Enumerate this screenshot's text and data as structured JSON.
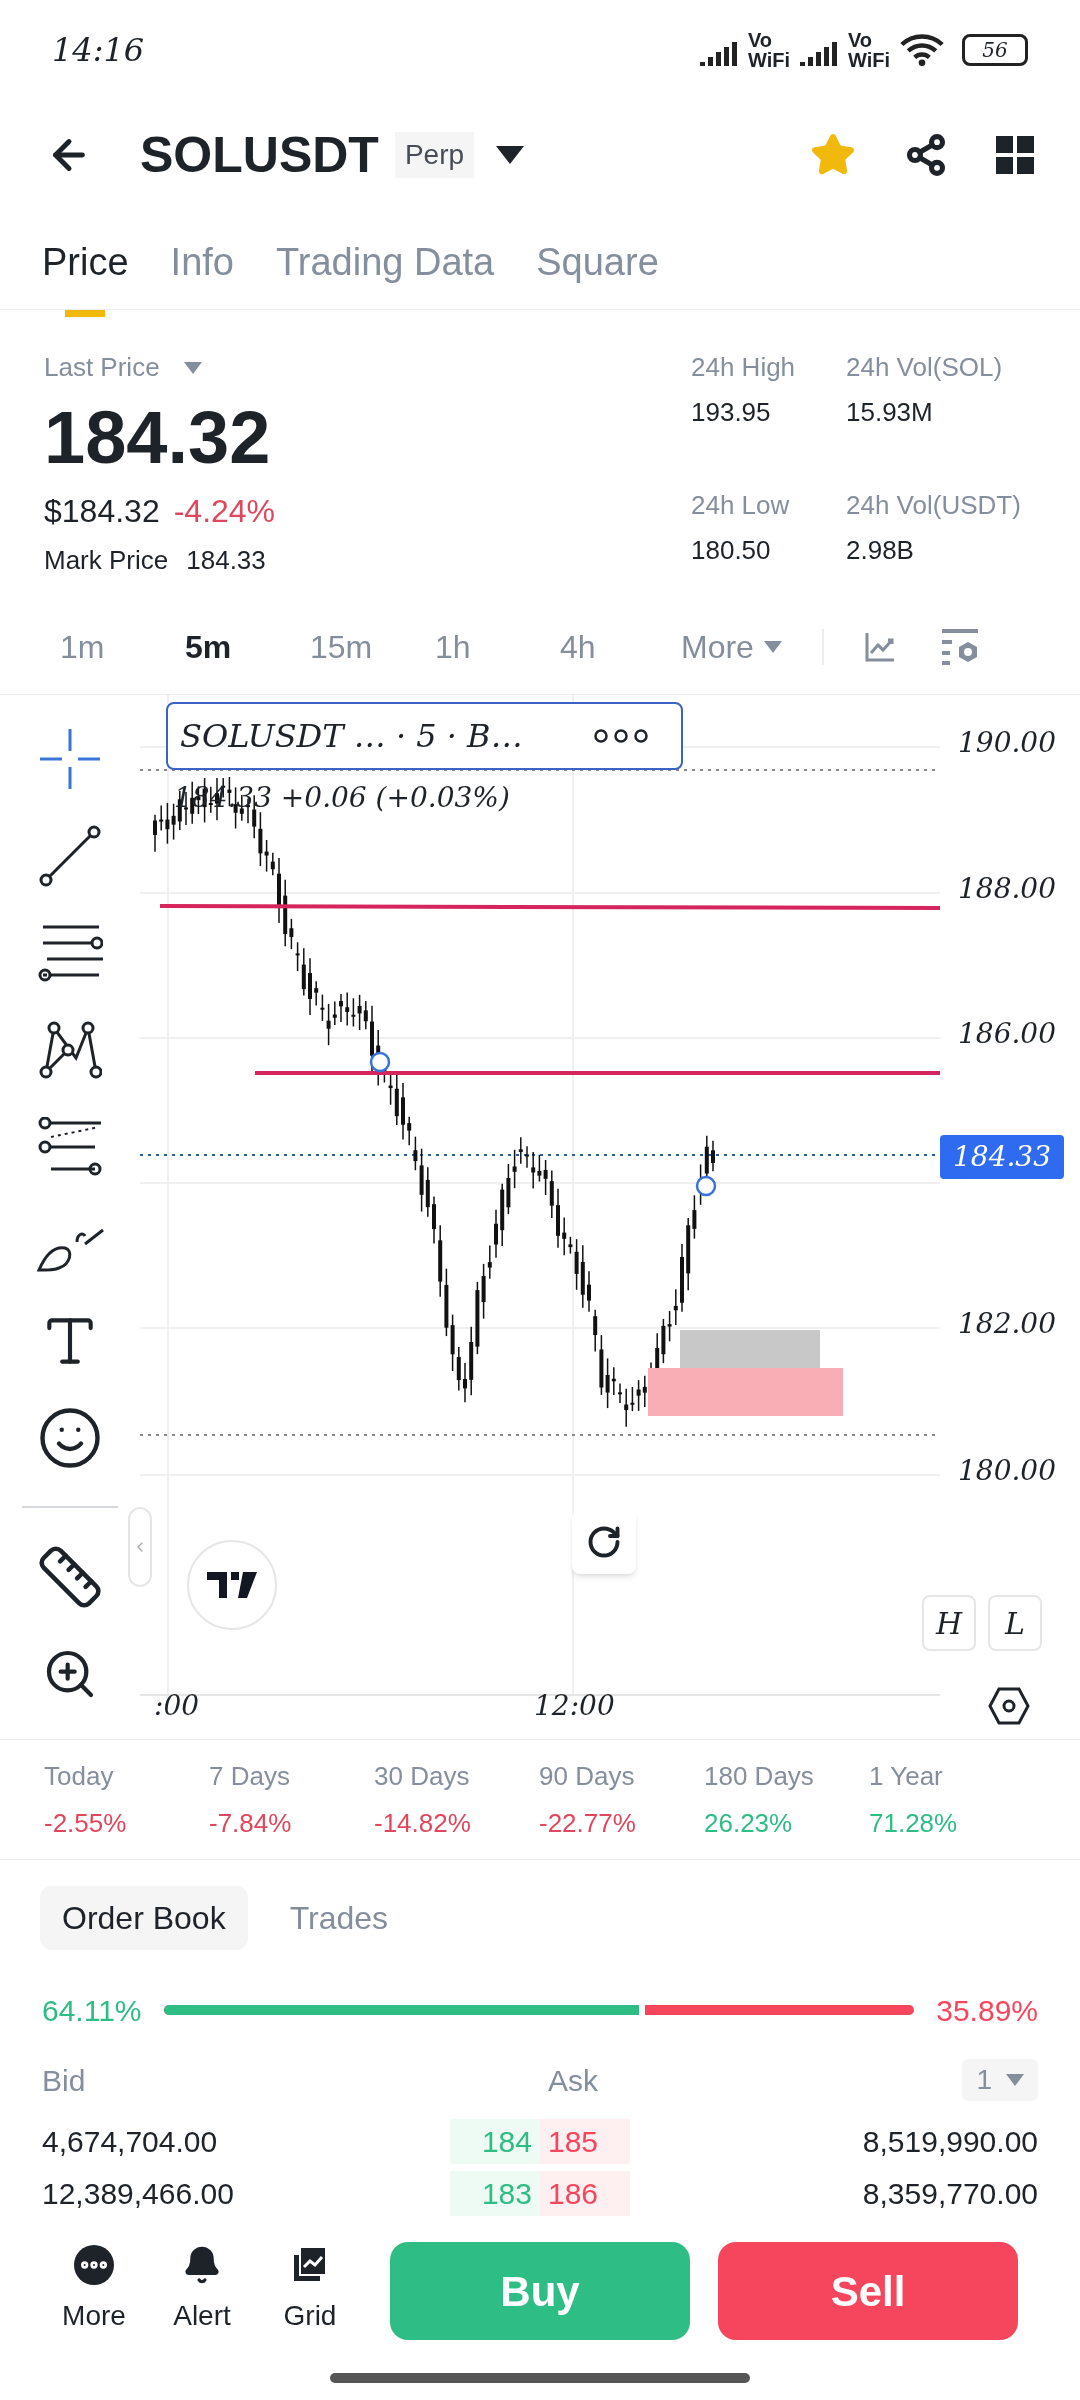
{
  "status_bar": {
    "time": "14:16",
    "sims": [
      {
        "top": "Vo",
        "bottom": "WiFi"
      },
      {
        "top": "Vo",
        "bottom": "WiFi"
      }
    ],
    "battery": "56"
  },
  "header": {
    "symbol": "SOLUSDT",
    "badge": "Perp",
    "favorite": true
  },
  "tabs": [
    {
      "label": "Price",
      "selected": true
    },
    {
      "label": "Info",
      "selected": false
    },
    {
      "label": "Trading Data",
      "selected": false
    },
    {
      "label": "Square",
      "selected": false
    }
  ],
  "price": {
    "label": "Last Price",
    "value": "184.32",
    "usd": "$184.32",
    "change": "-4.24%",
    "mark_label": "Mark Price",
    "mark_value": "184.33"
  },
  "stats": [
    {
      "label": "24h High",
      "value": "193.95"
    },
    {
      "label": "24h Vol(SOL)",
      "value": "15.93M"
    },
    {
      "label": "24h Low",
      "value": "180.50"
    },
    {
      "label": "24h Vol(USDT)",
      "value": "2.98B"
    }
  ],
  "intervals": [
    {
      "label": "1m",
      "selected": false
    },
    {
      "label": "5m",
      "selected": true
    },
    {
      "label": "15m",
      "selected": false
    },
    {
      "label": "1h",
      "selected": false
    },
    {
      "label": "4h",
      "selected": false
    }
  ],
  "more_label": "More",
  "chart": {
    "legend_title": "SOLUSDT …  · 5 · B…",
    "legend_ohlc": "184.33  +0.06 (+0.03%)",
    "y_labels": [
      "190.00",
      "188.00",
      "186.00",
      "182.00",
      "180.00"
    ],
    "current_price": "184.33",
    "x_labels": [
      ":00",
      "12:00"
    ],
    "hl_buttons": [
      "H",
      "L"
    ]
  },
  "performance": [
    {
      "label": "Today",
      "value": "-2.55%",
      "color": "#e0475c"
    },
    {
      "label": "7 Days",
      "value": "-7.84%",
      "color": "#e0475c"
    },
    {
      "label": "30 Days",
      "value": "-14.82%",
      "color": "#e0475c"
    },
    {
      "label": "90 Days",
      "value": "-22.77%",
      "color": "#e0475c"
    },
    {
      "label": "180 Days",
      "value": "26.23%",
      "color": "#2ebd85"
    },
    {
      "label": "1 Year",
      "value": "71.28%",
      "color": "#2ebd85"
    }
  ],
  "order_book": {
    "tabs": [
      {
        "label": "Order Book",
        "selected": true
      },
      {
        "label": "Trades",
        "selected": false
      }
    ],
    "bid_pct": "64.11%",
    "ask_pct": "35.89%",
    "level": 0.6411,
    "bid_label": "Bid",
    "ask_label": "Ask",
    "precision": "1",
    "rows": [
      {
        "bid_qty": "4,674,704.00",
        "bid_price": "184",
        "ask_price": "185",
        "ask_qty": "8,519,990.00"
      },
      {
        "bid_qty": "12,389,466.00",
        "bid_price": "183",
        "ask_price": "186",
        "ask_qty": "8,359,770.00"
      }
    ]
  },
  "bottom_bar": {
    "actions": [
      {
        "label": "More"
      },
      {
        "label": "Alert"
      },
      {
        "label": "Grid"
      }
    ],
    "buy": "Buy",
    "sell": "Sell"
  }
}
